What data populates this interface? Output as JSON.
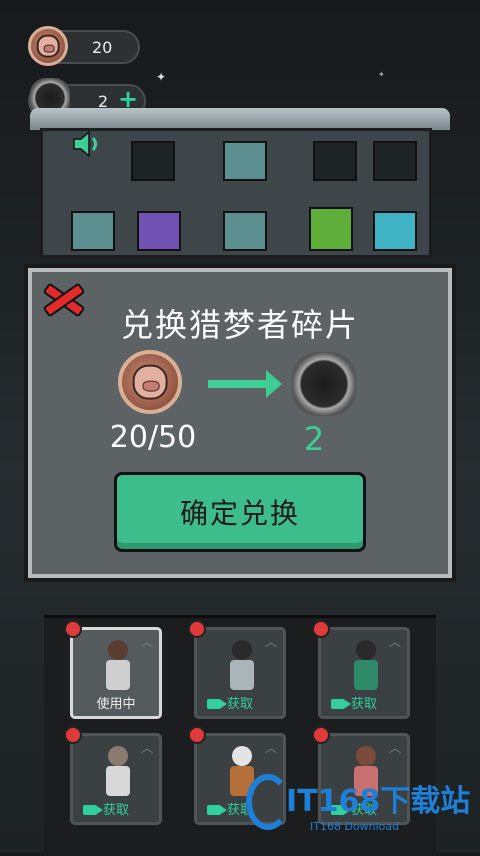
{
  "header": {
    "coins": "20",
    "fragments": "2",
    "plus": "+"
  },
  "modal": {
    "title": "兑换猎梦者碎片",
    "cost": "20/50",
    "reward": "2",
    "confirm_label": "确定兑换"
  },
  "characters": [
    {
      "label": "使用中",
      "active": true
    },
    {
      "label": "获取",
      "active": false
    },
    {
      "label": "获取",
      "active": false
    },
    {
      "label": "获取",
      "active": false
    },
    {
      "label": "获取",
      "active": false
    },
    {
      "label": "获取",
      "active": false
    }
  ],
  "watermark": {
    "brand": "IT168下载站",
    "sub": "IT168 Download"
  },
  "colors": {
    "accent": "#3dbd8b",
    "close": "#e32b2b",
    "badge": "#e03a3a"
  }
}
